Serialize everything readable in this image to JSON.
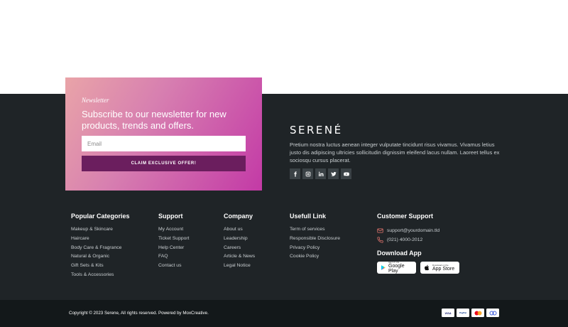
{
  "newsletter": {
    "eyebrow": "Newsletter",
    "title": "Subscribe to our newsletter for new products, trends and offers.",
    "email_placeholder": "Email",
    "button_label": "CLAIM EXCLUSIVE OFFER!",
    "gradient_colors": [
      "#e9a4a8",
      "#c33aa6"
    ],
    "button_color": "#6b1e5e"
  },
  "brand": {
    "logo": "SERENÉ",
    "description": "Pretium nostra luctus aenean integer vulputate tincidunt risus vivamus. Vivamus letius justo dis adipiscing ultricies sollicitudin dignissim eleifend lacus nullam. Laoreet tellus ex sociosqu cursus placerat.",
    "socials": [
      "facebook-icon",
      "instagram-icon",
      "linkedin-icon",
      "twitter-icon",
      "youtube-icon"
    ]
  },
  "columns": {
    "popular": {
      "title": "Popular Categories",
      "items": [
        "Makeup & Skincare",
        "Haircare",
        "Body Care & Fragrance",
        "Natural & Organic",
        "Gift Sets & Kits",
        "Tools & Accessories"
      ]
    },
    "support": {
      "title": "Support",
      "items": [
        "My Account",
        "Ticket Support",
        "Help Center",
        "FAQ",
        "Contact us"
      ]
    },
    "company": {
      "title": "Company",
      "items": [
        "About us",
        "Leadership",
        "Careers",
        "Article & News",
        "Legal Notice"
      ]
    },
    "useful": {
      "title": "Usefull Link",
      "items": [
        "Term of services",
        "Responsible Disclosure",
        "Privacy Policy",
        "Cookie Policy"
      ]
    },
    "customer_support": {
      "title": "Customer Support",
      "email": "support@yourdomain.tld",
      "phone": "(021) 4000-2012",
      "download_title": "Download App",
      "google_play_small": "GET IT ON",
      "google_play": "Google Play",
      "app_store_small": "Download on the",
      "app_store": "App Store",
      "icon_color": "#e8766f"
    }
  },
  "bottom": {
    "copyright": "Copyright © 2023 Serene, All rights reserved. Powered by MoxCreative.",
    "payments": [
      "VISA",
      "PayPal",
      "mastercard",
      "Stripe"
    ]
  },
  "colors": {
    "footer_bg": "#1f2427",
    "bottom_bar_bg": "#13181a"
  }
}
